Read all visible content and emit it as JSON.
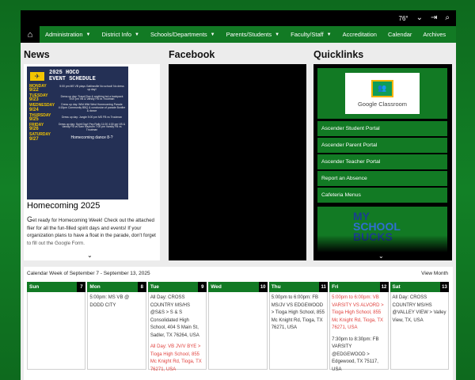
{
  "topbar": {
    "temperature": "76°"
  },
  "nav": {
    "items": [
      {
        "label": "Administration",
        "dropdown": true
      },
      {
        "label": "District Info",
        "dropdown": true
      },
      {
        "label": "Schools/Departments",
        "dropdown": true
      },
      {
        "label": "Parents/Students",
        "dropdown": true
      },
      {
        "label": "Faculty/Staff",
        "dropdown": true
      },
      {
        "label": "Accreditation",
        "dropdown": false
      },
      {
        "label": "Calendar",
        "dropdown": false
      },
      {
        "label": "Archives",
        "dropdown": false
      }
    ]
  },
  "sections": {
    "news": "News",
    "facebook": "Facebook",
    "quicklinks": "Quicklinks"
  },
  "news": {
    "flier": {
      "title_line1": "2025 HOCO",
      "title_line2": "EVENT SCHEDULE",
      "days": [
        {
          "day": "MONDAY",
          "date": "9/22",
          "event": "5:00 pm MS VB plays Gatlinsville  No school!  No dress up day!"
        },
        {
          "day": "TUESDAY",
          "date": "9/23",
          "event": "Dress up day: Travel Day & anything but a backpack  5:00 pm VB & Varsity FB vs Troutman"
        },
        {
          "day": "WEDNESDAY",
          "date": "9/24",
          "event": "Dress up day: Wild Wild West  Homecoming Parade 4:15pm  Community BBQ & conclusion of parade  Bonfire & dance"
        },
        {
          "day": "THURSDAY",
          "date": "9/25",
          "event": "Dress up day: Jungle  5:00 pm MS FB vs Troutman"
        },
        {
          "day": "FRIDAY",
          "date": "9/26",
          "event": "Dress up day: Spirit Day!  Pep Rally 11:00  4:30 pm VB & Varsity FB vs Sam Rayburn  7:00 pm Varsity FB vs Troutman"
        },
        {
          "day": "SATURDAY",
          "date": "9/27",
          "event": "Homecoming dance 8-?"
        }
      ]
    },
    "headline": "Homecoming 2025",
    "dropcap": "G",
    "body": "et ready for Homecoming Week! Check out the attached flier for all the fun-filled spirit days and events! If your organization plans to have a float in the parade, don't forget to fill out the Google Form."
  },
  "quicklinks": {
    "classroom_label": "Google Classroom",
    "links": [
      "Ascender Student Portal",
      "Ascender Parent Portal",
      "Ascender Teacher Portal",
      "Report an Absence",
      "Cafeteria Menus"
    ],
    "msb_line1": "MY",
    "msb_line2": "SCHOOL",
    "msb_line3": "BUCKS"
  },
  "calendar": {
    "title": "Calendar Week of September 7 - September 13, 2025",
    "view_month": "View Month",
    "days": [
      {
        "name": "Sun",
        "num": "7",
        "events": []
      },
      {
        "name": "Mon",
        "num": "8",
        "events": [
          {
            "text": "5:00pm: MS VB @ DODD CITY",
            "color": "#333333"
          }
        ]
      },
      {
        "name": "Tue",
        "num": "9",
        "events": [
          {
            "text": "All Day: CROSS COUNTRY MS/HS @S&S > S & S Consolidated High School, 404 S Main St, Sadler, TX 76264, USA",
            "color": "#333333"
          },
          {
            "text": "All Day: VB JV/V BYE > Tioga High School, 855 Mc Knight Rd, Tioga, TX 76271, USA",
            "color": "#e0423e"
          }
        ]
      },
      {
        "name": "Wed",
        "num": "10",
        "events": []
      },
      {
        "name": "Thu",
        "num": "11",
        "events": [
          {
            "text": "5:00pm to 6:00pm: FB MS/JV VS EDGEWOOD > Tioga High School, 855 Mc Knight Rd, Tioga, TX 76271, USA",
            "color": "#333333"
          }
        ]
      },
      {
        "name": "Fri",
        "num": "12",
        "events": [
          {
            "text": "5:00pm to 6:00pm: VB VARSITY VS ALVORD > Tioga High School, 855 Mc Knight Rd, Tioga, TX 76271, USA",
            "color": "#e0423e"
          },
          {
            "text": "7:30pm to 8:30pm: FB VARSITY @EDGEWOOD > Edgewood, TX 75117, USA",
            "color": "#333333"
          }
        ]
      },
      {
        "name": "Sat",
        "num": "13",
        "events": [
          {
            "text": "All Day: CROSS COUNTRY MS/HS @VALLEY VIEW > Valley View, TX, USA",
            "color": "#333333"
          }
        ]
      }
    ]
  },
  "colors": {
    "brand_green": "#127a24",
    "flier_navy": "#243055",
    "flier_gold": "#f2c400",
    "event_red": "#e0423e"
  }
}
